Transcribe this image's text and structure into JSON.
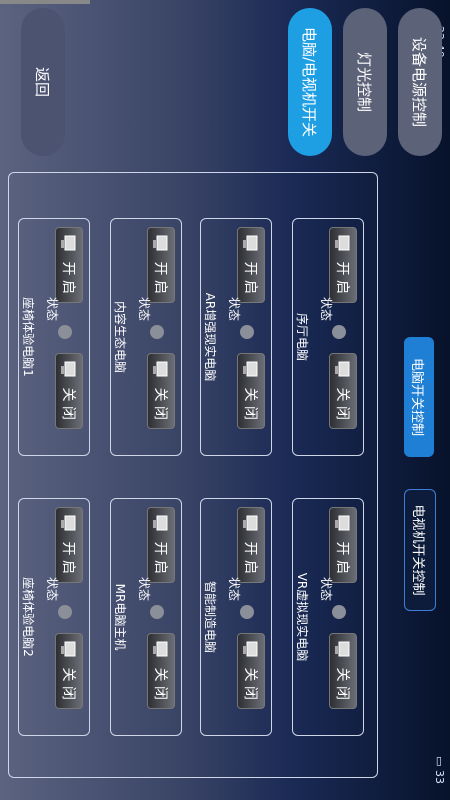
{
  "status": {
    "time": "22:40",
    "battery": "33"
  },
  "tabs": [
    {
      "label": "设备电源控制",
      "active": false
    },
    {
      "label": "灯光控制",
      "active": false
    },
    {
      "label": "电脑/电视机开关",
      "active": true
    }
  ],
  "back_label": "返回",
  "side_buttons": [
    {
      "label": "电脑开关控制",
      "active": true
    },
    {
      "label": "电视机开关控制",
      "active": false
    }
  ],
  "card_labels": {
    "on": "开 启",
    "off": "关 闭",
    "state": "状态"
  },
  "cards": [
    {
      "name": "序厅电脑"
    },
    {
      "name": "AR增强现实电脑"
    },
    {
      "name": "内容生态电脑"
    },
    {
      "name": "座椅体验电脑1"
    },
    {
      "name": "VR虚拟现实电脑"
    },
    {
      "name": "智能制造电脑"
    },
    {
      "name": "MR电脑主机"
    },
    {
      "name": "座椅体验电脑2"
    }
  ],
  "colors": {
    "accent": "#1f9fe3",
    "inactive": "#5c6378"
  }
}
